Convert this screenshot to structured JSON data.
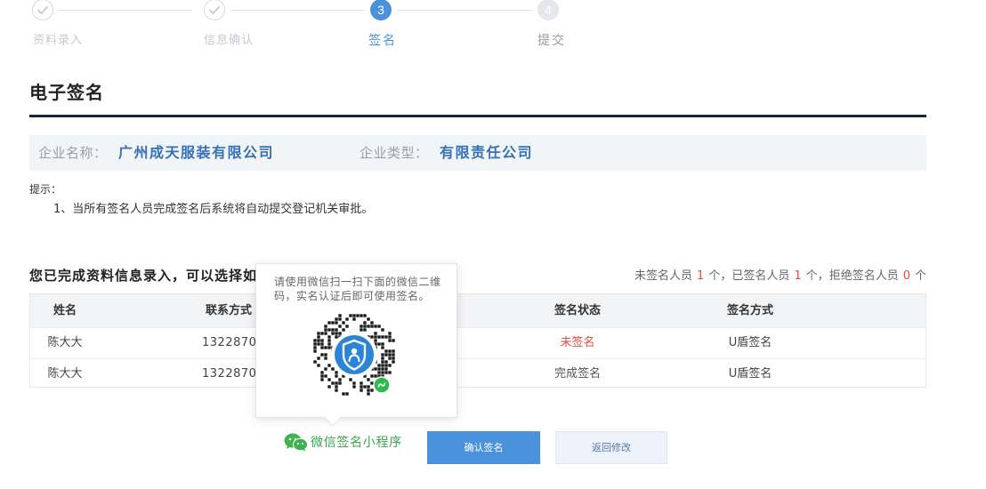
{
  "steps": [
    {
      "label": "资料录入",
      "state": "done"
    },
    {
      "label": "信息确认",
      "state": "done"
    },
    {
      "index": "3",
      "label": "签名",
      "state": "active"
    },
    {
      "index": "4",
      "label": "提交",
      "state": "pending"
    }
  ],
  "page_title": "电子签名",
  "company": {
    "name_label": "企业名称：",
    "name": "广州成天服装有限公司",
    "type_label": "企业类型：",
    "type": "有限责任公司"
  },
  "notice": {
    "title": "提示：",
    "items": [
      "1、当所有签名人员完成签名后系统将自动提交登记机关审批。"
    ]
  },
  "signing": {
    "intro": "您已完成资料信息录入，可以选择如",
    "summary": {
      "unsigned_label": "未签名人员",
      "unsigned_count": "1",
      "signed_label": "已签名人员",
      "signed_count": "1",
      "refused_label": "拒绝签名人员",
      "refused_count": "0",
      "unit": "个",
      "separator": "，"
    }
  },
  "table": {
    "columns": {
      "name": "姓名",
      "phone": "联系方式",
      "status": "签名状态",
      "method": "签名方式"
    },
    "rows": [
      {
        "name": "陈大大",
        "phone": "13228709",
        "status": "未签名",
        "status_color": "#e5483d",
        "method": "U盾签名"
      },
      {
        "name": "陈大大",
        "phone": "13228709",
        "status": "完成签名",
        "status_color": "#555555",
        "method": "U盾签名"
      }
    ]
  },
  "qr_popup": {
    "instruction": "请使用微信扫一扫下面的微信二维码，实名认证后即可使用签名。",
    "qr_icon": "wechat-mini-program-code",
    "wechat_icon": "wechat-icon",
    "wechat_label": "微信签名小程序"
  },
  "actions": {
    "confirm_label": "确认签名",
    "back_label": "返回修改"
  },
  "colors": {
    "accent": "#4a92dc",
    "danger": "#e5483d",
    "wechat_green": "#36a84a",
    "rule": "#1d2733"
  }
}
